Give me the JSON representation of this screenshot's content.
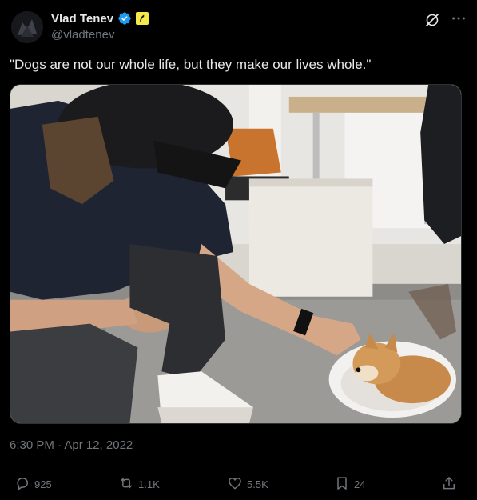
{
  "author": {
    "display_name": "Vlad Tenev",
    "handle": "@vladtenev",
    "avatar_icon": "avatar-image",
    "verified_icon": "verified-badge-icon",
    "affiliation_icon": "robinhood-feather-icon"
  },
  "header_icons": {
    "grok": "grok-icon",
    "more": "more-icon"
  },
  "tweet": {
    "text": "\"Dogs are not our whole life, but they make our lives whole.\"",
    "timestamp": "6:30 PM · Apr 12, 2022"
  },
  "media": {
    "icon": "photo-man-with-shiba-dog"
  },
  "actions": {
    "replies": "925",
    "reposts": "1.1K",
    "likes": "5.5K",
    "bookmarks": "24"
  },
  "colors": {
    "background": "#000000",
    "text_primary": "#e7e9ea",
    "text_secondary": "#71767b",
    "verified_blue": "#1d9bf0",
    "affiliation_yellow": "#f5e94a",
    "divider": "#2f3336"
  }
}
